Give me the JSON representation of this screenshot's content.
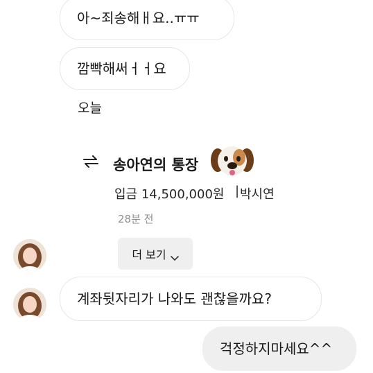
{
  "messages": {
    "incoming_1": "아~죄송해ㅐ요..ㅠㅠ",
    "incoming_2": "깜빡해써ㅓㅓ요",
    "day_label": "오늘",
    "incoming_question": "계좌뒷자리가 나와도 괜찮을까요?",
    "outgoing_reply": "걱정하지마세요^^"
  },
  "transfer": {
    "icon": "transfer-arrows-icon",
    "title": "송아연의 통장",
    "title_emoji": "🐶",
    "amount": "입금 14,500,000원",
    "separator": "|",
    "sender": "박시연",
    "time_ago": "28분 전",
    "more_label": "더 보기",
    "more_icon": "chevron-down-icon"
  },
  "colors": {
    "outgoing_bubble": "#efefef",
    "incoming_border": "#e6e6e6",
    "muted_text": "#8e8e8e"
  }
}
